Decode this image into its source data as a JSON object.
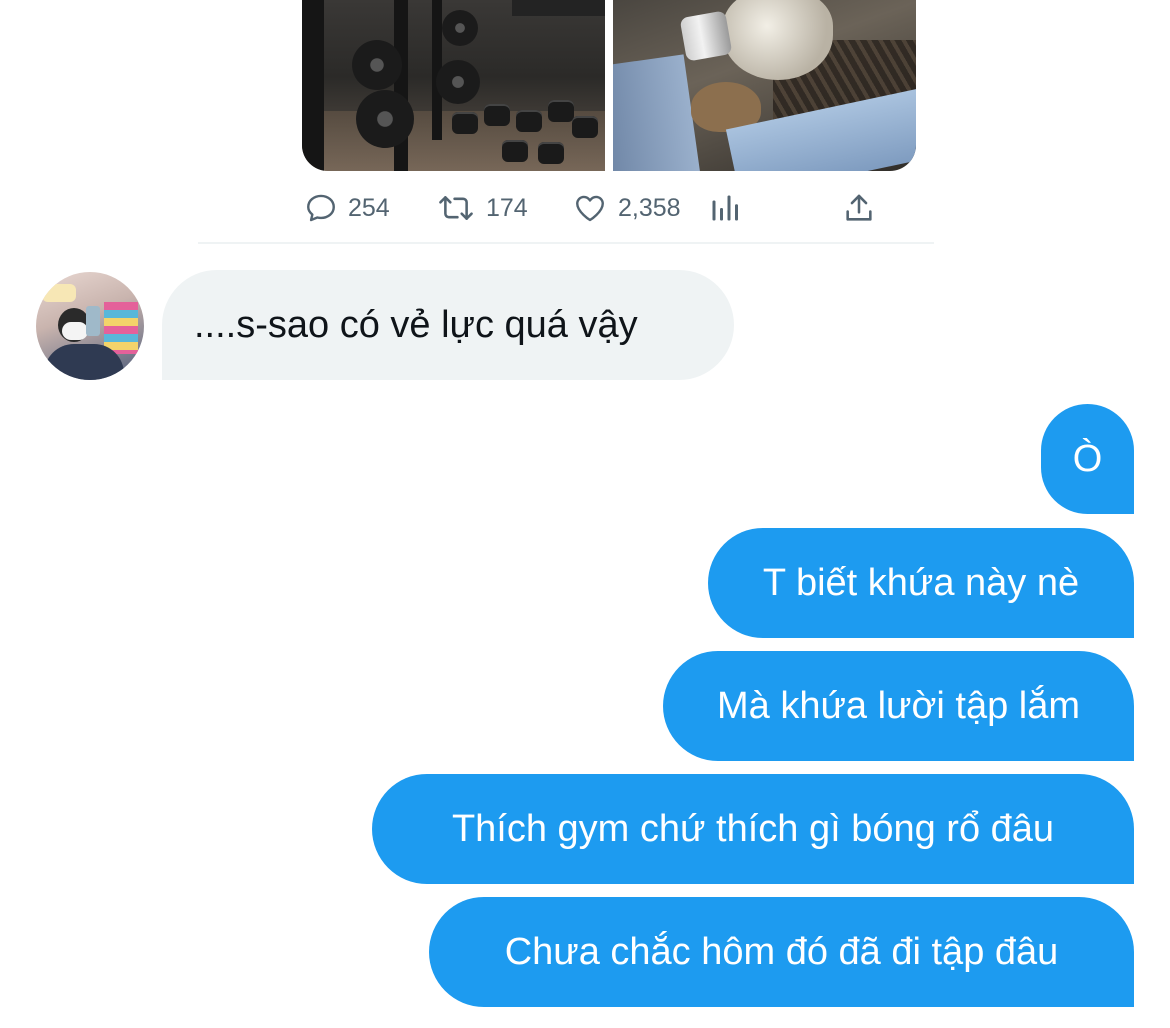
{
  "tweet": {
    "stats": {
      "replies": "254",
      "retweets": "174",
      "likes": "2,358"
    },
    "icons": {
      "reply": "reply-icon",
      "retweet": "retweet-icon",
      "like": "heart-icon",
      "analytics": "analytics-icon",
      "share": "share-icon"
    }
  },
  "chat": {
    "incoming": [
      {
        "text": "....s-sao có vẻ lực quá vậy"
      }
    ],
    "outgoing": [
      {
        "text": "Ò"
      },
      {
        "text": "T biết khứa này nè"
      },
      {
        "text": "Mà khứa lười tập lắm"
      },
      {
        "text": "Thích gym chứ thích gì bóng rổ đâu"
      },
      {
        "text": "Chưa chắc hôm đó đã đi tập đâu"
      }
    ]
  },
  "colors": {
    "accent": "#1d9bf0",
    "incoming_bubble": "#eff3f4",
    "secondary_text": "#536471"
  }
}
